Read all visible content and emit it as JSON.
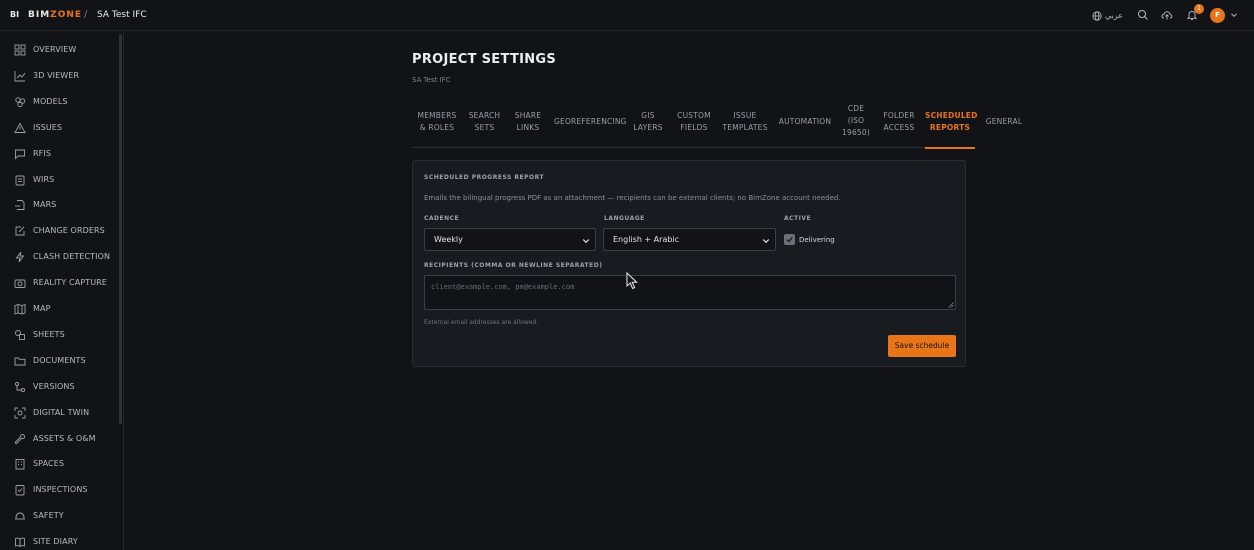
{
  "topbar": {
    "logo_mark": "BI",
    "logo_text_a": "BIM",
    "logo_text_b": "ZONE",
    "crumb_sep": "/",
    "project": "SA Test IFC",
    "language_toggle": "عربي",
    "notification_count": "1",
    "avatar_initial": "F"
  },
  "sidebar": {
    "items": [
      {
        "label": "OVERVIEW",
        "icon": "overview-icon"
      },
      {
        "label": "3D VIEWER",
        "icon": "chart-icon"
      },
      {
        "label": "MODELS",
        "icon": "models-icon"
      },
      {
        "label": "ISSUES",
        "icon": "warning-icon"
      },
      {
        "label": "RFIS",
        "icon": "message-icon"
      },
      {
        "label": "WIRS",
        "icon": "clipboard-icon"
      },
      {
        "label": "MARS",
        "icon": "mars-icon"
      },
      {
        "label": "CHANGE ORDERS",
        "icon": "edit-icon"
      },
      {
        "label": "CLASH DETECTION",
        "icon": "lightning-icon"
      },
      {
        "label": "REALITY CAPTURE",
        "icon": "camera-icon"
      },
      {
        "label": "MAP",
        "icon": "map-icon"
      },
      {
        "label": "SHEETS",
        "icon": "sheets-icon"
      },
      {
        "label": "DOCUMENTS",
        "icon": "folder-icon"
      },
      {
        "label": "VERSIONS",
        "icon": "versions-icon"
      },
      {
        "label": "DIGITAL TWIN",
        "icon": "scan-icon"
      },
      {
        "label": "ASSETS & O&M",
        "icon": "wrench-icon"
      },
      {
        "label": "SPACES",
        "icon": "building-icon"
      },
      {
        "label": "INSPECTIONS",
        "icon": "checklist-icon"
      },
      {
        "label": "SAFETY",
        "icon": "hardhat-icon"
      },
      {
        "label": "SITE DIARY",
        "icon": "book-icon"
      }
    ]
  },
  "page": {
    "title": "PROJECT SETTINGS",
    "subtitle": "SA Test IFC"
  },
  "tabs": [
    {
      "line1": "MEMBERS",
      "line2": "& ROLES",
      "line3": ""
    },
    {
      "line1": "SEARCH",
      "line2": "SETS",
      "line3": ""
    },
    {
      "line1": "SHARE",
      "line2": "LINKS",
      "line3": ""
    },
    {
      "line1": "GEOREFERENCING",
      "line2": "",
      "line3": ""
    },
    {
      "line1": "GIS",
      "line2": "LAYERS",
      "line3": ""
    },
    {
      "line1": "CUSTOM",
      "line2": "FIELDS",
      "line3": ""
    },
    {
      "line1": "ISSUE",
      "line2": "TEMPLATES",
      "line3": ""
    },
    {
      "line1": "AUTOMATION",
      "line2": "",
      "line3": ""
    },
    {
      "line1": "CDE",
      "line2": "(ISO",
      "line3": "19650)"
    },
    {
      "line1": "FOLDER",
      "line2": "ACCESS",
      "line3": ""
    },
    {
      "line1": "SCHEDULED",
      "line2": "REPORTS",
      "line3": ""
    },
    {
      "line1": "GENERAL",
      "line2": "",
      "line3": ""
    }
  ],
  "card": {
    "title": "SCHEDULED PROGRESS REPORT",
    "description": "Emails the bilingual progress PDF as an attachment — recipients can be external clients; no BimZone account needed.",
    "cadence_label": "CADENCE",
    "cadence_value": "Weekly",
    "language_label": "LANGUAGE",
    "language_value": "English + Arabic",
    "active_label": "ACTIVE",
    "active_checkbox_label": "Delivering",
    "recipients_label": "RECIPIENTS (COMMA OR NEWLINE SEPARATED)",
    "recipients_placeholder": "client@example.com, pm@example.com",
    "recipients_value": "",
    "hint": "External email addresses are allowed.",
    "save_label": "Save schedule"
  },
  "colors": {
    "accent": "#e87518",
    "background": "#111317",
    "card": "#181b20"
  }
}
